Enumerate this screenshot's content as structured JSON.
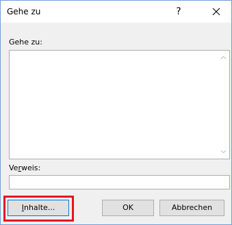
{
  "window": {
    "title": "Gehe zu",
    "help_glyph": "?",
    "close_icon": "close-icon"
  },
  "goto_label": "Gehe zu:",
  "goto_list": {
    "items": []
  },
  "reference": {
    "label_pre": "Ve",
    "label_accel": "r",
    "label_post": "weis:",
    "value": ""
  },
  "buttons": {
    "contents_accel": "I",
    "contents_rest": "nhalte...",
    "ok": "OK",
    "cancel": "Abbrechen"
  },
  "colors": {
    "highlight": "#e81123",
    "focus": "#0078d7",
    "window_border": "#6f9fd8"
  }
}
